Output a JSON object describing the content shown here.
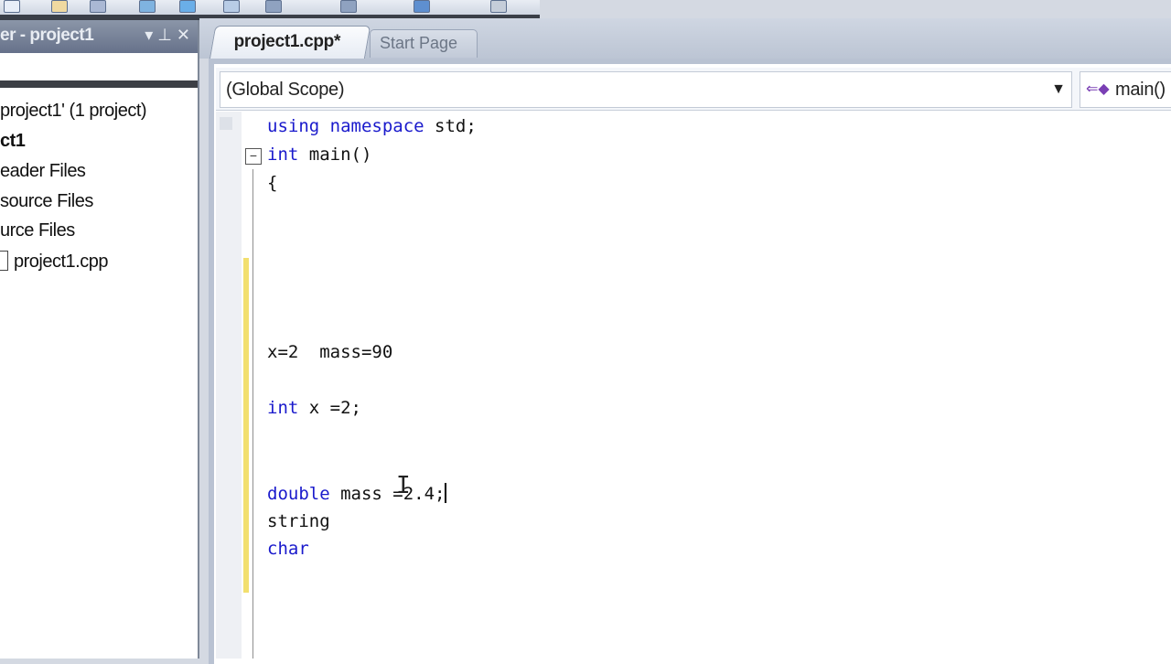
{
  "toolbar": {
    "icons": [
      "new-icon",
      "open-icon",
      "save-icon",
      "cut-icon",
      "copy-icon",
      "paste-icon",
      "undo-icon",
      "redo-icon",
      "debug-icon",
      "find-icon"
    ]
  },
  "solution_explorer": {
    "title": "er - project1",
    "tree": [
      {
        "label": "project1' (1 project)",
        "bold": false
      },
      {
        "label": "ct1",
        "bold": true
      },
      {
        "label": "eader Files",
        "bold": false
      },
      {
        "label": "source Files",
        "bold": false
      },
      {
        "label": "urce Files",
        "bold": false
      },
      {
        "label": "project1.cpp",
        "bold": false
      }
    ]
  },
  "tabs": [
    {
      "label": "project1.cpp*",
      "active": true
    },
    {
      "label": "Start Page",
      "active": false
    }
  ],
  "scope": {
    "left": "(Global Scope)",
    "right": "main()"
  },
  "code": {
    "line1_kw1": "using",
    "line1_kw2": "namespace",
    "line1_rest": " std;",
    "line2_kw": "int",
    "line2_rest": " main()",
    "line3": "{",
    "line4": "x=2  mass=90",
    "line5_kw": "int",
    "line5_rest": " x =2;",
    "line6_kw": "double",
    "line6_rest": " mass =2.4;",
    "line7": "string",
    "line8_kw": "char"
  },
  "colors": {
    "keyword": "#1a1acc",
    "change_bar": "#f2df6e"
  }
}
